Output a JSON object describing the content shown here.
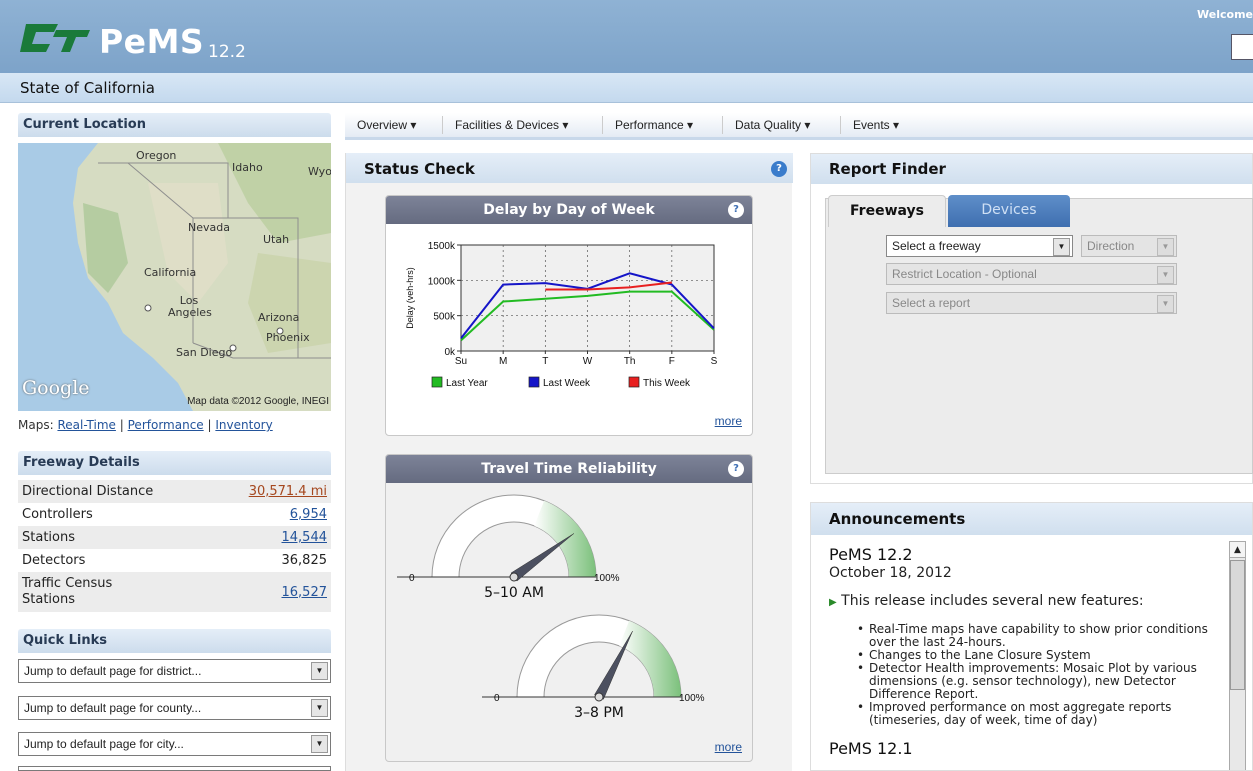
{
  "header": {
    "logo_mark": "Ct",
    "app_name": "PeMS",
    "version": "12.2",
    "welcome": "Welcome",
    "state": "State of California"
  },
  "current_location": {
    "title": "Current Location",
    "map": {
      "labels": [
        "Oregon",
        "Idaho",
        "Wyor",
        "Nevada",
        "Utah",
        "California",
        "Los Angeles",
        "Arizona",
        "Phoenix",
        "San Diego"
      ],
      "google": "Google",
      "attribution": "Map data ©2012 Google, INEGI"
    },
    "maps_prefix": "Maps:",
    "maps_links": [
      "Real-Time",
      "Performance",
      "Inventory"
    ],
    "sep": "|"
  },
  "freeway_details": {
    "title": "Freeway Details",
    "rows": [
      {
        "label": "Directional Distance",
        "value": "30,571.4 mi"
      },
      {
        "label": "Controllers",
        "value": "6,954"
      },
      {
        "label": "Stations",
        "value": "14,544"
      },
      {
        "label": "Detectors",
        "value": "36,825"
      },
      {
        "label": "Traffic Census Stations",
        "value": "16,527"
      }
    ]
  },
  "quick_links": {
    "title": "Quick Links",
    "selects": [
      "Jump to default page for district...",
      "Jump to default page for county...",
      "Jump to default page for city..."
    ]
  },
  "nav": {
    "items": [
      "Overview",
      "Facilities & Devices",
      "Performance",
      "Data Quality",
      "Events"
    ],
    "caret": "▾"
  },
  "status_check": {
    "title": "Status Check",
    "help": "?",
    "delay_widget": {
      "title": "Delay by Day of Week",
      "more": "more"
    },
    "reliability_widget": {
      "title": "Travel Time Reliability",
      "more": "more",
      "gauges": [
        {
          "label": "5–10 AM",
          "min": "0",
          "max": "100%",
          "value_fraction": 0.8
        },
        {
          "label": "3–8 PM",
          "min": "0",
          "max": "100%",
          "value_fraction": 0.65
        }
      ]
    }
  },
  "chart_data": {
    "type": "line",
    "title": "Delay by Day of Week",
    "ylabel": "Delay (veh-hrs)",
    "xlabel": "",
    "categories": [
      "Su",
      "M",
      "T",
      "W",
      "Th",
      "F",
      "S"
    ],
    "yticks": [
      "0k",
      "500k",
      "1000k",
      "1500k"
    ],
    "ylim": [
      0,
      1500000
    ],
    "grid": true,
    "legend": "bottom",
    "series": [
      {
        "name": "Last Year",
        "color": "#22bb22",
        "values": [
          150000,
          700000,
          740000,
          780000,
          840000,
          840000,
          300000
        ]
      },
      {
        "name": "Last Week",
        "color": "#1515c8",
        "values": [
          180000,
          940000,
          960000,
          880000,
          1100000,
          940000,
          320000
        ]
      },
      {
        "name": "This Week",
        "color": "#e82020",
        "values": [
          null,
          null,
          870000,
          870000,
          900000,
          970000,
          null
        ]
      }
    ]
  },
  "report_finder": {
    "title": "Report Finder",
    "tabs": [
      "Freeways",
      "Devices"
    ],
    "freeway_select": "Select a freeway",
    "direction_select": "Direction",
    "location_select": "Restrict Location - Optional",
    "report_select": "Select a report"
  },
  "announcements": {
    "title": "Announcements",
    "entries": [
      {
        "version": "PeMS 12.2",
        "date": "October 18, 2012",
        "intro": "This release includes several new features:",
        "items": [
          "Real-Time maps have capability to show prior conditions over the last 24-hours.",
          "Changes to the Lane Closure System",
          "Detector Health improvements: Mosaic Plot by various dimensions (e.g. sensor technology), new Detector Difference Report.",
          "Improved performance on most aggregate reports (timeseries, day of week, time of day)"
        ]
      },
      {
        "version": "PeMS 12.1"
      }
    ]
  }
}
